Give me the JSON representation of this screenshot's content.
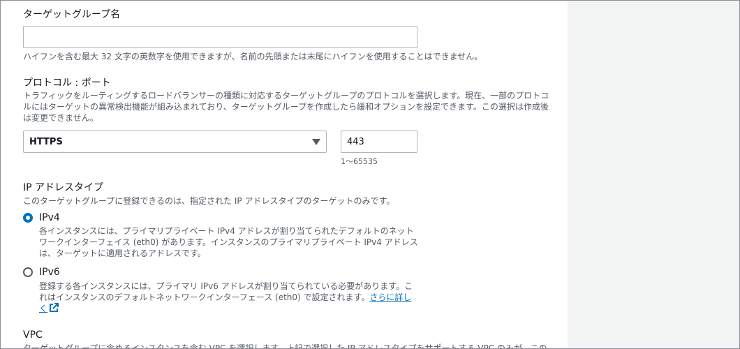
{
  "target_group_name": {
    "label": "ターゲットグループ名",
    "value": "",
    "placeholder": "",
    "help": "ハイフンを含む最大 32 文字の英数字を使用できますが、名前の先頭または末尾にハイフンを使用することはできません。"
  },
  "protocol_port": {
    "label": "プロトコル : ポート",
    "description_lines": [
      "トラフィックをルーティングするロードバランサーの種類に対応するターゲットグループのプロトコルを選択します。現在、一部のプロトコ",
      "ルにはターゲットの異常検出機能が組み込まれており、ターゲットグループを作成したら緩和オプションを設定できます。この選択は作成後",
      "は変更できません。"
    ],
    "protocol_value": "HTTPS",
    "port_value": "443",
    "port_constraint": "1〜65535"
  },
  "ip_address_type": {
    "label": "IP アドレスタイプ",
    "description": "このターゲットグループに登録できるのは、指定された IP アドレスタイプのターゲットのみです。",
    "options": [
      {
        "label": "IPv4",
        "checked": true,
        "description_lines": [
          "各インスタンスには、プライマリプライベート IPv4 アドレスが割り当てられたデフォルトのネット",
          "ワークインターフェイス (eth0) があります。インスタンスのプライマリプライベート IPv4 アドレス",
          "は、ターゲットに適用されるアドレスです。"
        ]
      },
      {
        "label": "IPv6",
        "checked": false,
        "description_lines": [
          "登録する各インスタンスには、プライマリ IPv6 アドレスが割り当てられている必要があります。こ",
          "れはインスタンスのデフォルトネットワークインターフェース (eth0) で設定されます。"
        ],
        "link_part1": "さらに詳し",
        "link_part2": "く"
      }
    ]
  },
  "vpc": {
    "label": "VPC",
    "description_partial": "ターゲットグループに含めるインスタンスを含む VPC を選択します。上記で選択した IP アドレスタイプをサポートする VPC のみが、この"
  },
  "colors": {
    "link": "#0073bb",
    "radio_selected": "#0073bb",
    "input_border": "#aab7b8",
    "secondary_text": "#545b64"
  }
}
